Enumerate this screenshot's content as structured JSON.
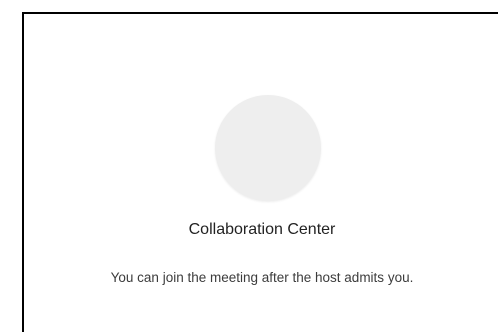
{
  "dialog": {
    "title": "Collaboration Center",
    "message": "You can join the meeting after the host admits you."
  },
  "colors": {
    "avatar_fill": "#eeeeee",
    "frame_border": "#000000",
    "title_text": "#222222",
    "message_text": "#3c3c3c"
  }
}
